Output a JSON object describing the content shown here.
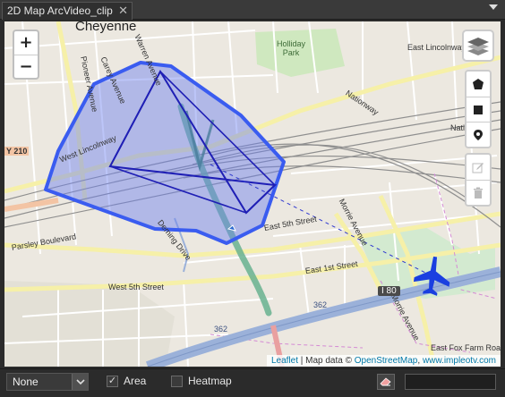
{
  "window": {
    "tab_title": "2D Map ArcVideo_clip",
    "close_glyph": "✕"
  },
  "map": {
    "zoom_in": "+",
    "zoom_out": "−",
    "labels": {
      "cheyenne": "Cheyenne",
      "holliday_park": "Holliday\nPark",
      "east_lincolnway": "East Lincolnway",
      "west_lincolnway": "West Lincolnway",
      "nationway": "Nationway",
      "nationway_short": "Natio",
      "carey_avenue": "Carey Avenue",
      "warren_avenue": "Warren Avenue",
      "pioneer_avenue": "Pioneer Avenue",
      "y210": "Y 210",
      "parsley_boulevard": "Parsley Boulevard",
      "deming_drive": "Deming Drive",
      "east_5th_street": "East 5th Street",
      "east_1st_street": "East 1st Street",
      "west_5th_street": "West 5th Street",
      "morrie_avenue_top": "Morrie Avenue",
      "morrie_avenue_bottom": "Morrie Avenue",
      "i80": "I 80",
      "route_362_a": "362",
      "route_362_b": "362",
      "east_fox_farm_road": "East Fox Farm Road"
    },
    "attribution": {
      "leaflet": "Leaflet",
      "separator": " | Map data © ",
      "osm": "OpenStreetMap",
      "comma": ", ",
      "implemo": "www.impleotv.com"
    },
    "colors": {
      "footprint_fill": "#6a7ef0",
      "footprint_stroke": "#3a5cf0",
      "frame_stroke": "#1f1fb5",
      "aircraft": "#1a3fe0",
      "track_line": "#69b18f"
    },
    "icons": [
      "layers-icon",
      "polygon-icon",
      "rectangle-icon",
      "marker-icon",
      "edit-icon",
      "trash-icon",
      "aircraft-icon"
    ]
  },
  "bottom_bar": {
    "mode_select": "None",
    "area_checked": true,
    "area_label": "Area",
    "heatmap_checked": false,
    "heatmap_label": "Heatmap",
    "check_glyph": "✓",
    "text_value": ""
  }
}
